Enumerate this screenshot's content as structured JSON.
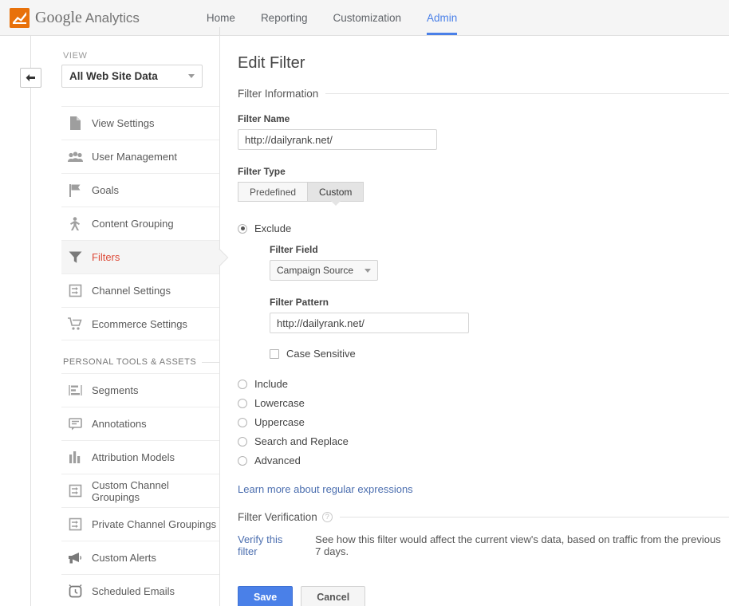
{
  "header": {
    "brand_google": "Google",
    "brand_product": "Analytics",
    "logo_icon": "analytics-logo-icon",
    "nav": [
      {
        "label": "Home",
        "active": false
      },
      {
        "label": "Reporting",
        "active": false
      },
      {
        "label": "Customization",
        "active": false
      },
      {
        "label": "Admin",
        "active": true
      }
    ],
    "accent_color": "#4a80e8"
  },
  "rail": {
    "back_button_icon": "back-arrow-icon"
  },
  "sidebar": {
    "view_label": "VIEW",
    "view_value": "All Web Site Data",
    "items": [
      {
        "label": "View Settings",
        "icon": "document-icon"
      },
      {
        "label": "User Management",
        "icon": "people-icon"
      },
      {
        "label": "Goals",
        "icon": "flag-icon"
      },
      {
        "label": "Content Grouping",
        "icon": "person-walking-icon"
      },
      {
        "label": "Filters",
        "icon": "funnel-icon",
        "selected": true
      },
      {
        "label": "Channel Settings",
        "icon": "channel-arrows-icon"
      },
      {
        "label": "Ecommerce Settings",
        "icon": "shopping-cart-icon"
      }
    ],
    "section_title": "PERSONAL TOOLS & ASSETS",
    "personal_items": [
      {
        "label": "Segments",
        "icon": "segments-icon"
      },
      {
        "label": "Annotations",
        "icon": "comment-icon"
      },
      {
        "label": "Attribution Models",
        "icon": "bar-chart-icon"
      },
      {
        "label": "Custom Channel Groupings",
        "icon": "channel-arrows-icon"
      },
      {
        "label": "Private Channel Groupings",
        "icon": "channel-arrows-icon"
      },
      {
        "label": "Custom Alerts",
        "icon": "megaphone-icon"
      },
      {
        "label": "Scheduled Emails",
        "icon": "alarm-clock-icon"
      }
    ],
    "selected_color": "#dd4b39"
  },
  "main": {
    "page_title": "Edit Filter",
    "filter_information_heading": "Filter Information",
    "filter_name_label": "Filter Name",
    "filter_name_value": "http://dailyrank.net/",
    "filter_name_placeholder": "Filter Name",
    "filter_type_label": "Filter Type",
    "tabs": [
      {
        "label": "Predefined",
        "active": false
      },
      {
        "label": "Custom",
        "active": true
      }
    ],
    "exclude_option": {
      "label": "Exclude",
      "selected": true
    },
    "filter_field_label": "Filter Field",
    "filter_field_value": "Campaign Source",
    "filter_pattern_label": "Filter Pattern",
    "filter_pattern_value": "http://dailyrank.net/",
    "filter_pattern_placeholder": "Filter Pattern",
    "case_sensitive_label": "Case Sensitive",
    "case_sensitive_checked": false,
    "other_options": [
      {
        "label": "Include",
        "selected": false
      },
      {
        "label": "Lowercase",
        "selected": false
      },
      {
        "label": "Uppercase",
        "selected": false
      },
      {
        "label": "Search and Replace",
        "selected": false
      },
      {
        "label": "Advanced",
        "selected": false
      }
    ],
    "regex_link": "Learn more about regular expressions",
    "verification_heading": "Filter Verification",
    "verification_help_icon": "question-mark-icon",
    "verify_link": "Verify this filter",
    "verify_note": "See how this filter would affect the current view's data, based on traffic from the previous 7 days.",
    "save_label": "Save",
    "cancel_label": "Cancel"
  }
}
